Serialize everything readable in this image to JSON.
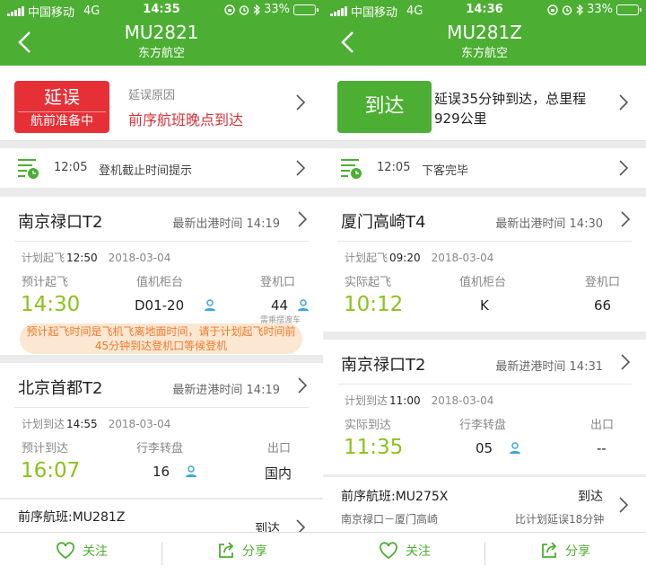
{
  "left": {
    "status": {
      "carrier": "中国移动",
      "network": "4G",
      "time": "14:35",
      "battery": "33%"
    },
    "nav": {
      "flight_no": "MU2821",
      "airline": "东方航空"
    },
    "state": {
      "badge_main": "延误",
      "badge_sub": "航前准备中",
      "reason_label": "延误原因",
      "reason_text": "前序航班晚点到达"
    },
    "notice": {
      "time": "12:05",
      "text": "登机截止时间提示"
    },
    "dep": {
      "airport": "南京禄口T2",
      "latest": "最新出港时间 14:19",
      "sched_label": "计划起飞",
      "sched_time": "12:50",
      "sched_date": "2018-03-04",
      "c1_label": "预计起飞",
      "c1_value": "14:30",
      "c2_label": "值机柜台",
      "c2_value": "D01-20",
      "c3_label": "登机口",
      "c3_value": "44",
      "c3_note": "需乘摆渡车",
      "tip": "预计起飞时间是飞机飞离地面时间，请于计划起飞时间前45分钟到达登机口等候登机"
    },
    "arr": {
      "airport": "北京首都T2",
      "latest": "最新进港时间 14:19",
      "sched_label": "计划到达",
      "sched_time": "14:55",
      "sched_date": "2018-03-04",
      "c1_label": "预计到达",
      "c1_value": "16:07",
      "c2_label": "行李转盘",
      "c2_value": "16",
      "c3_label": "出口",
      "c3_value": "国内"
    },
    "prev": {
      "title": "前序航班:MU281Z",
      "state": "到达"
    },
    "footer": {
      "follow": "关注",
      "share": "分享"
    }
  },
  "right": {
    "status": {
      "carrier": "中国移动",
      "network": "4G",
      "time": "14:36",
      "battery": "33%"
    },
    "nav": {
      "flight_no": "MU281Z",
      "airline": "东方航空"
    },
    "state": {
      "badge_main": "到达",
      "text": "延误35分钟到达，总里程929公里"
    },
    "notice": {
      "time": "12:05",
      "text": "下客完毕"
    },
    "dep": {
      "airport": "厦门高崎T4",
      "latest": "最新出港时间 14:30",
      "sched_label": "计划起飞",
      "sched_time": "09:20",
      "sched_date": "2018-03-04",
      "c1_label": "实际起飞",
      "c1_value": "10:12",
      "c2_label": "值机柜台",
      "c2_value": "K",
      "c3_label": "登机口",
      "c3_value": "66"
    },
    "arr": {
      "airport": "南京禄口T2",
      "latest": "最新进港时间 14:31",
      "sched_label": "计划到达",
      "sched_time": "11:00",
      "sched_date": "2018-03-04",
      "c1_label": "实际到达",
      "c1_value": "11:35",
      "c2_label": "行李转盘",
      "c2_value": "05",
      "c3_label": "出口",
      "c3_value": "--"
    },
    "prev": {
      "title": "前序航班:MU275X",
      "state": "到达",
      "route": "南京禄口－厦门高崎",
      "delay": "比计划延误18分钟"
    },
    "footer": {
      "follow": "关注",
      "share": "分享"
    }
  },
  "icons": {
    "signal": "signal-bars-icon",
    "lock": "rotation-lock-icon",
    "alarm": "alarm-icon",
    "bluetooth": "bluetooth-icon",
    "battery": "battery-icon",
    "back": "back-chevron-icon",
    "chevron": "chevron-right-icon",
    "notice": "clock-list-icon",
    "person": "person-icon",
    "heart": "heart-icon",
    "share": "share-icon"
  },
  "colors": {
    "brand": "#4caf33",
    "delay": "#e63036",
    "time_green": "#8bc21c",
    "tip_text": "#ef7a2b",
    "tip_bg": "#fbe7d2"
  }
}
